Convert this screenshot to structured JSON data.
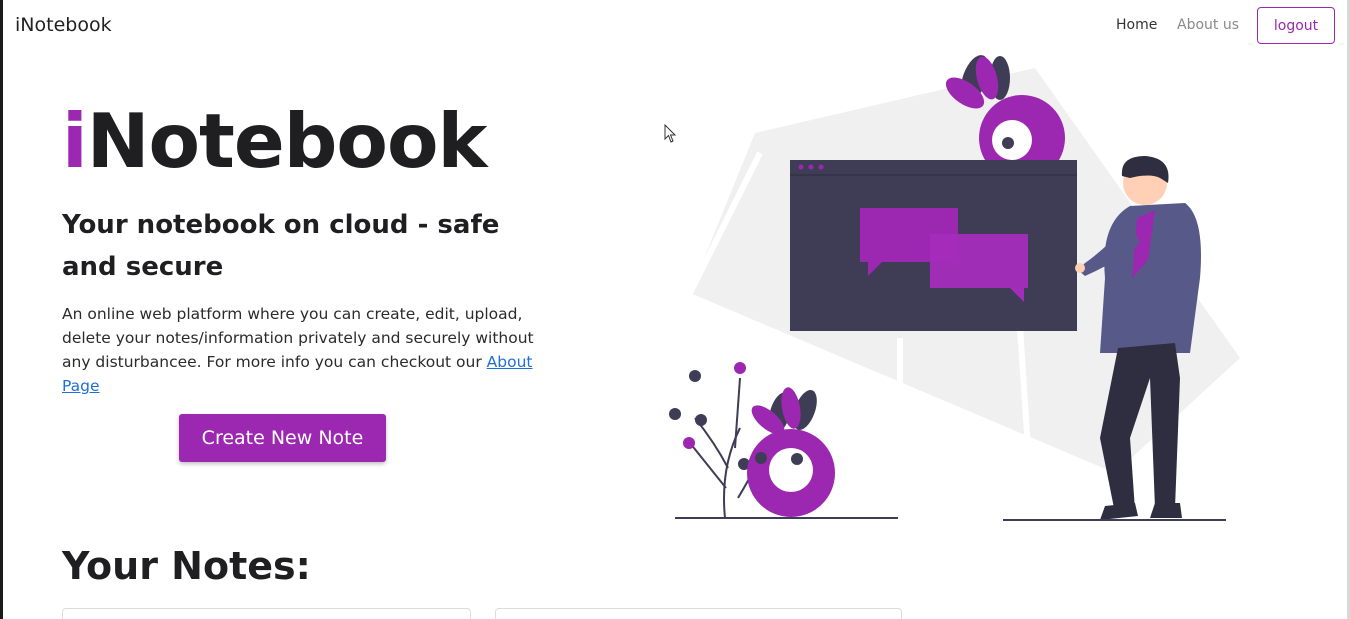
{
  "navbar": {
    "brand": "iNotebook",
    "links": [
      {
        "label": "Home"
      },
      {
        "label": "About us"
      }
    ],
    "logout_label": "logout"
  },
  "hero": {
    "title_first_letter": "i",
    "title_rest": "Notebook",
    "subtitle": "Your notebook on cloud - safe and secure",
    "description": "An online web platform where you can create, edit, upload, delete your notes/information privately and securely without any disturbancee. For more info you can checkout our ",
    "about_link_label": "About Page",
    "create_button_label": "Create New Note"
  },
  "notes_section": {
    "heading": "Your Notes:"
  },
  "colors": {
    "accent": "#9c27b0",
    "dark": "#3f3d56",
    "link": "#1e6fd9"
  }
}
